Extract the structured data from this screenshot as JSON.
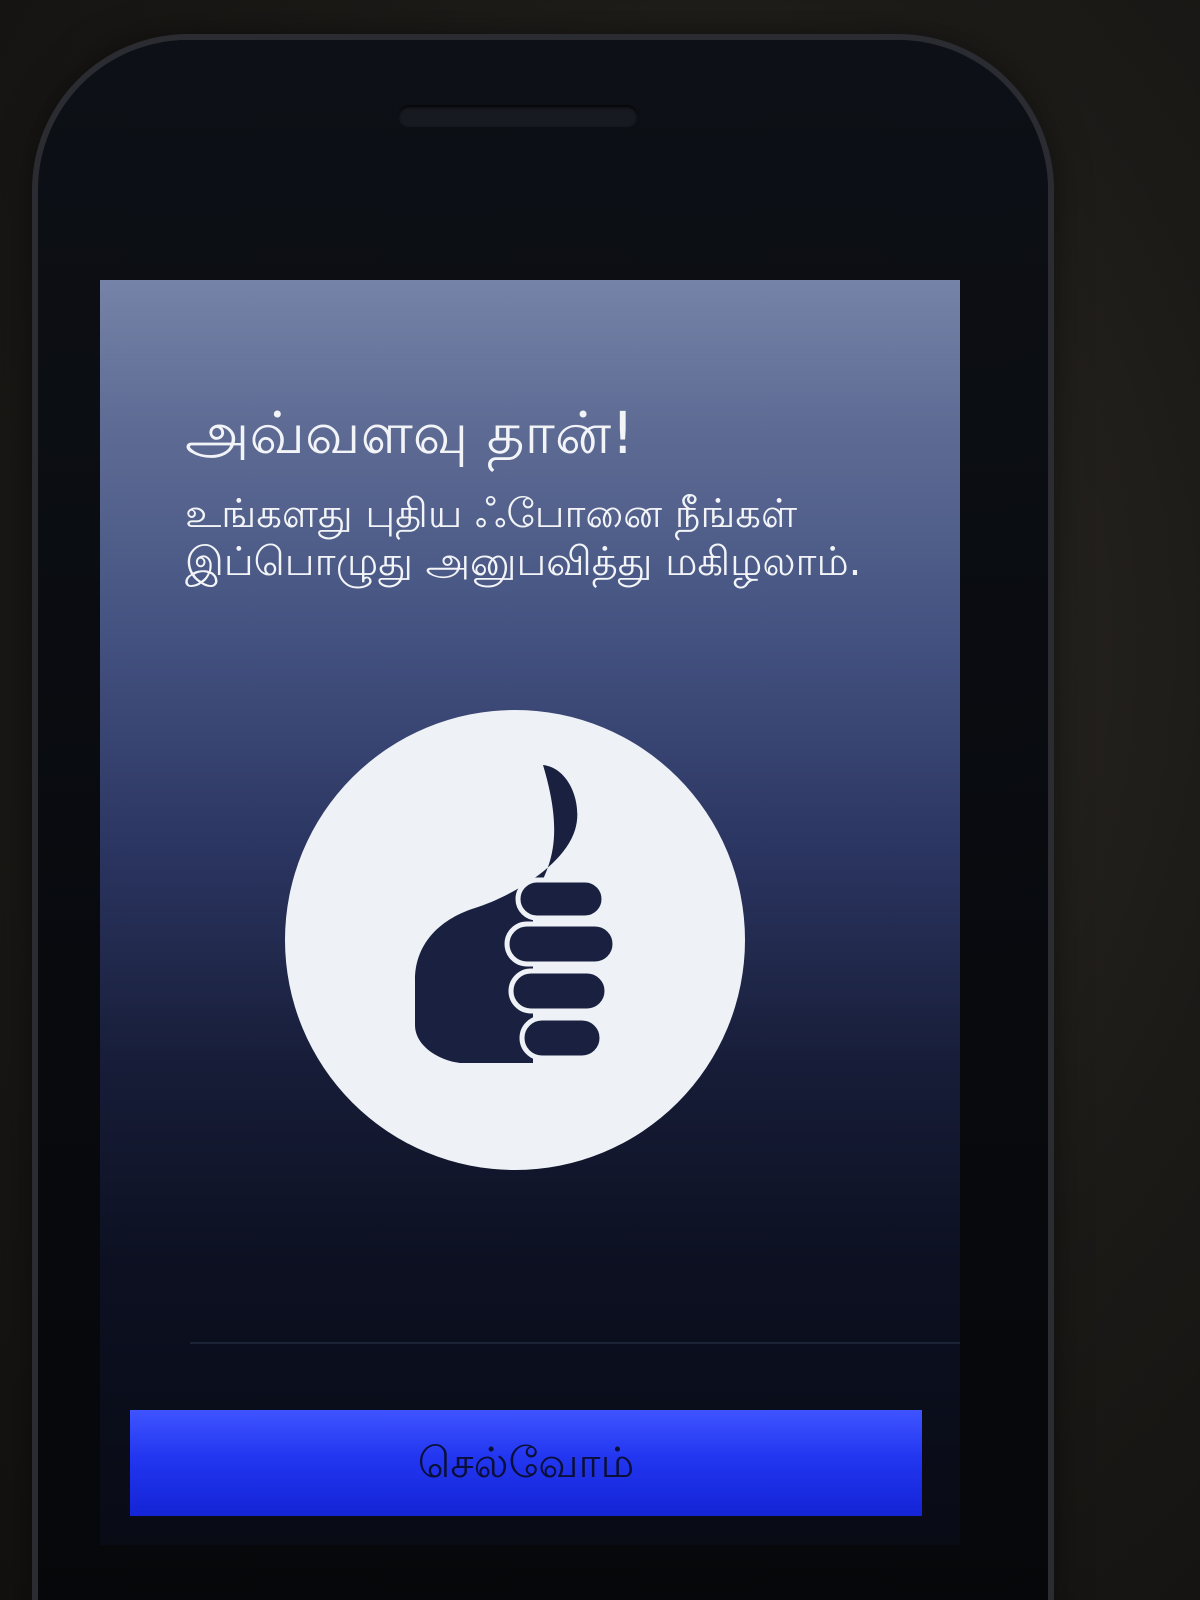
{
  "screen": {
    "headline": "அவ்வளவு தான்!",
    "message": "உங்களது புதிய ஃபோனை நீங்கள் இப்பொழுது அனுபவித்து மகிழலாம்.",
    "illustration_icon": "thumbs-up-icon",
    "continue_button_label": "செல்வோம்"
  },
  "colors": {
    "screen_top": "#7583a8",
    "screen_bottom": "#090b15",
    "button_accent": "#2236f0",
    "icon_disc": "#eef2f7",
    "icon_fill": "#1a2140"
  }
}
